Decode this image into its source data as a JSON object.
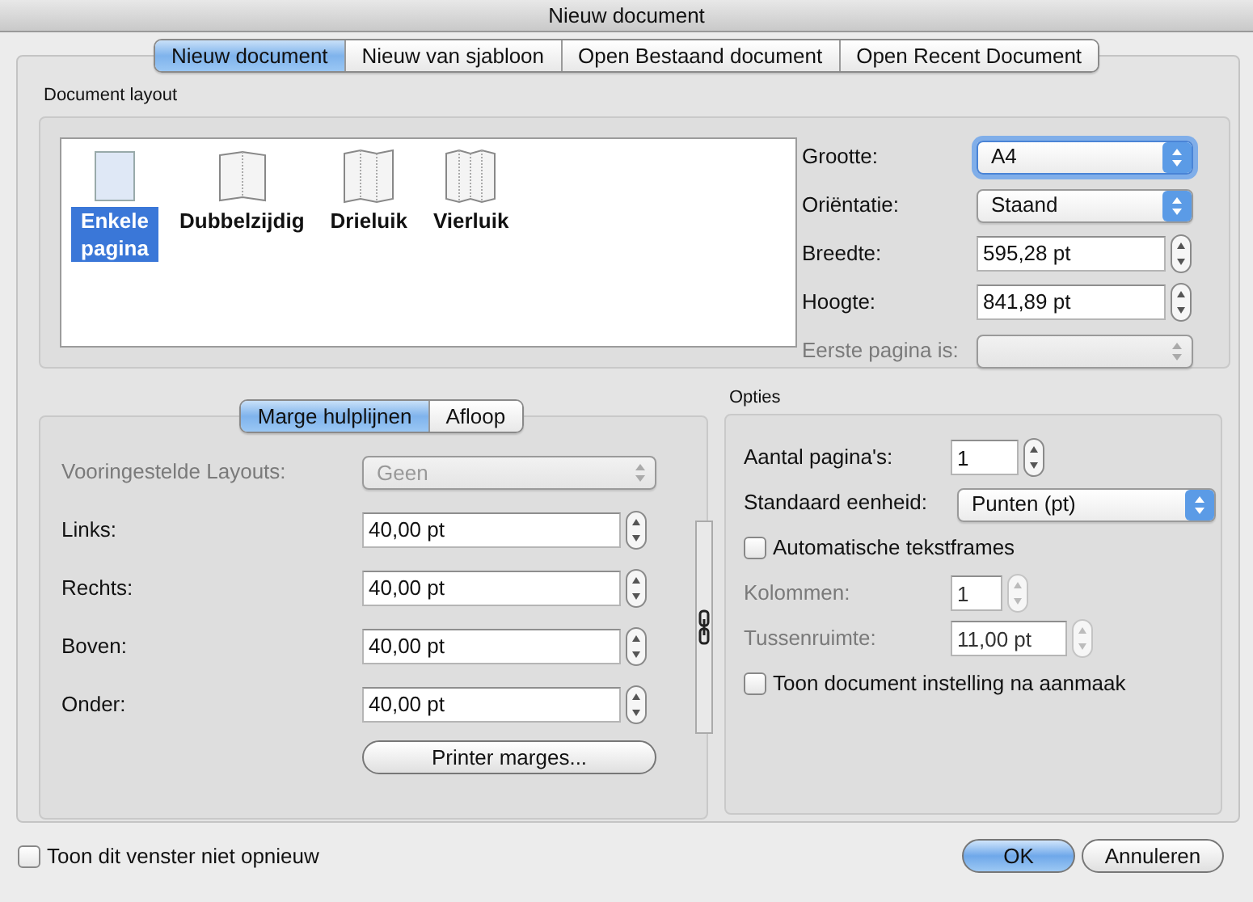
{
  "window": {
    "title": "Nieuw document"
  },
  "tabs": [
    {
      "label": "Nieuw document",
      "selected": true
    },
    {
      "label": "Nieuw van sjabloon",
      "selected": false
    },
    {
      "label": "Open Bestaand document",
      "selected": false
    },
    {
      "label": "Open Recent Document",
      "selected": false
    }
  ],
  "document_layout": {
    "title": "Document layout",
    "layouts": [
      {
        "label": "Enkele pagina",
        "kind": "single",
        "selected": true
      },
      {
        "label": "Dubbelzijdig",
        "kind": "bifold",
        "selected": false
      },
      {
        "label": "Drieluik",
        "kind": "trifold",
        "selected": false
      },
      {
        "label": "Vierluik",
        "kind": "quadfold",
        "selected": false
      }
    ],
    "fields": [
      {
        "label": "Grootte:",
        "kind": "select",
        "value": "A4",
        "focused": true,
        "disabled": false
      },
      {
        "label": "Oriëntatie:",
        "kind": "select",
        "value": "Staand",
        "focused": false,
        "disabled": false
      },
      {
        "label": "Breedte:",
        "kind": "stepper",
        "value": "595,28 pt",
        "focused": false,
        "disabled": false
      },
      {
        "label": "Hoogte:",
        "kind": "stepper",
        "value": "841,89 pt",
        "focused": false,
        "disabled": false
      },
      {
        "label": "Eerste pagina is:",
        "kind": "select",
        "focused": false,
        "disabled": true
      }
    ]
  },
  "margins": {
    "tabs": [
      {
        "label": "Marge hulplijnen",
        "selected": true
      },
      {
        "label": "Afloop",
        "selected": false
      }
    ],
    "fields": [
      {
        "label": "Vooringestelde Layouts:",
        "kind": "select",
        "value": "Geen",
        "disabled": true
      },
      {
        "label": "Links:",
        "kind": "stepper",
        "value": "40,00 pt",
        "disabled": false
      },
      {
        "label": "Rechts:",
        "kind": "stepper",
        "value": "40,00 pt",
        "disabled": false
      },
      {
        "label": "Boven:",
        "kind": "stepper",
        "value": "40,00 pt",
        "disabled": false
      },
      {
        "label": "Onder:",
        "kind": "stepper",
        "value": "40,00 pt",
        "disabled": false
      }
    ],
    "button": "Printer marges..."
  },
  "options": {
    "title": "Opties",
    "items": [
      {
        "kind": "stepper",
        "label": "Aantal pagina's:",
        "value": "1",
        "disabled": false
      },
      {
        "kind": "select",
        "label": "Standaard eenheid:",
        "value": "Punten (pt)",
        "disabled": false
      },
      {
        "kind": "checkbox",
        "label": "Automatische tekstframes",
        "checked": false
      },
      {
        "kind": "stepper",
        "label": "Kolommen:",
        "value": "1",
        "disabled": true
      },
      {
        "kind": "stepper",
        "label": "Tussenruimte:",
        "value": "11,00 pt",
        "disabled": true
      },
      {
        "kind": "checkbox",
        "label": "Toon document instelling na aanmaak",
        "checked": false
      }
    ]
  },
  "footer": {
    "checkbox": {
      "label": "Toon dit venster niet opnieuw",
      "checked": false
    },
    "buttons": [
      {
        "label": "OK",
        "default": true
      },
      {
        "label": "Annuleren",
        "default": false
      }
    ]
  }
}
